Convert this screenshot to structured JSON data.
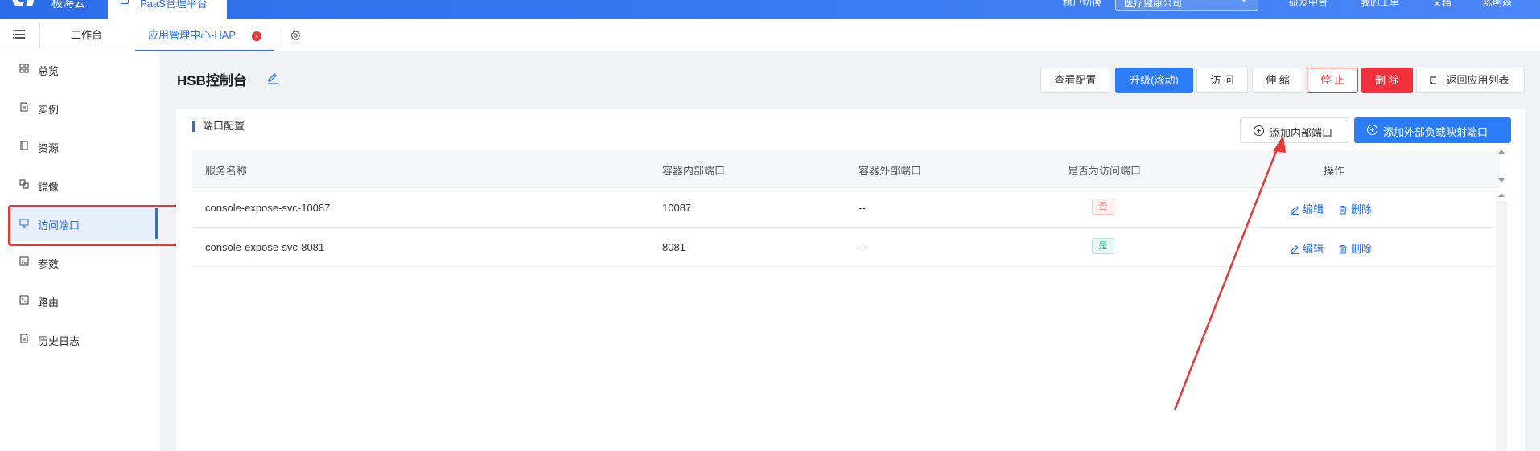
{
  "topbar": {
    "brand": "极海云",
    "paas_tab": "PaaS管理平台",
    "tenant_label": "租户切换",
    "tenant_value": "医疗健康公司",
    "nav": [
      "研发中台",
      "我的工单",
      "文档",
      "陈明森"
    ]
  },
  "tabs": {
    "workbench": "工作台",
    "app_center": "应用管理中心-HAP",
    "close_glyph": "×"
  },
  "sidebar": {
    "items": [
      {
        "label": "总览",
        "icon": "grid-icon"
      },
      {
        "label": "实例",
        "icon": "file-icon"
      },
      {
        "label": "资源",
        "icon": "book-icon"
      },
      {
        "label": "镜像",
        "icon": "copy-icon"
      },
      {
        "label": "访问端口",
        "icon": "monitor-icon"
      },
      {
        "label": "参数",
        "icon": "terminal-icon"
      },
      {
        "label": "路由",
        "icon": "terminal-icon"
      },
      {
        "label": "历史日志",
        "icon": "file-icon"
      }
    ],
    "active_index": 4
  },
  "header": {
    "title": "HSB控制台",
    "buttons": {
      "view_config": "查看配置",
      "upgrade": "升级(滚动)",
      "access": "访 问",
      "scale": "伸 缩",
      "stop": "停 止",
      "delete": "删 除",
      "back": "返回应用列表"
    }
  },
  "port_config": {
    "section_title": "端口配置",
    "add_internal": "添加内部端口",
    "add_external": "添加外部负载映射端口",
    "columns": [
      "服务名称",
      "容器内部端口",
      "容器外部端口",
      "是否为访问端口",
      "操作"
    ],
    "rows": [
      {
        "name": "console-expose-svc-10087",
        "internal": "10087",
        "external": "--",
        "is_access": "否",
        "edit": "编辑",
        "delete": "删除"
      },
      {
        "name": "console-expose-svc-8081",
        "internal": "8081",
        "external": "--",
        "is_access": "是",
        "edit": "编辑",
        "delete": "删除"
      }
    ]
  },
  "colors": {
    "primary": "#2b7cf6",
    "danger": "#f0303a",
    "annotation": "#e53935"
  }
}
